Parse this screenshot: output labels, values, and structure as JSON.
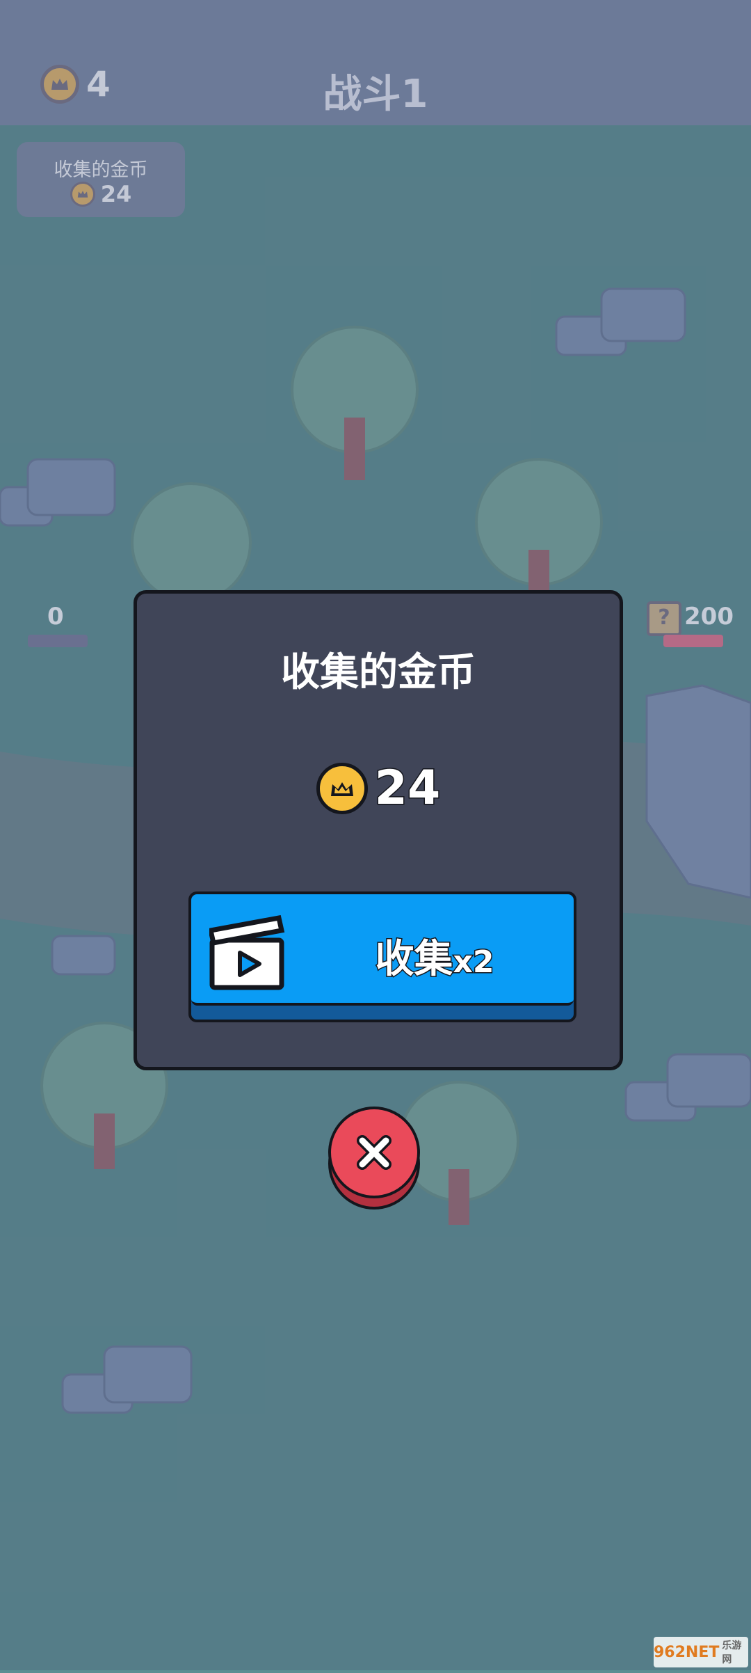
{
  "header": {
    "crown_count": "4",
    "title": "战斗1"
  },
  "collected_panel": {
    "label": "收集的金币",
    "value": "24"
  },
  "battlefield": {
    "left_hp": "0",
    "right_hp": "200",
    "mystery_label": "?"
  },
  "modal": {
    "title": "收集的金币",
    "coin_amount": "24",
    "collect_button": {
      "label": "收集",
      "multiplier": "x2"
    }
  },
  "watermark": {
    "text": "962NET",
    "sub": "乐游网"
  },
  "colors": {
    "accent": "#0a9cf5",
    "close": "#ea4a5a",
    "coin": "#f7bf3c",
    "panel": "#404558"
  },
  "icons": [
    "crown-coin-icon",
    "video-clapper-icon",
    "close-x-icon",
    "mystery-box-icon"
  ]
}
